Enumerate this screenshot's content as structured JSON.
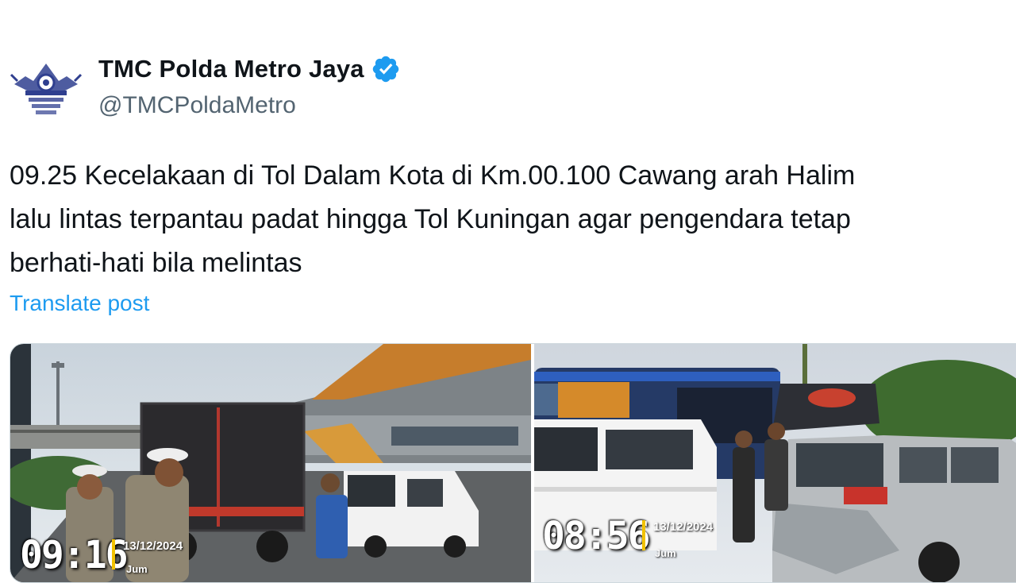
{
  "post": {
    "author": {
      "display_name": "TMC Polda Metro Jaya",
      "handle": "@TMCPoldaMetro",
      "avatar_icon": "police-emblem-icon",
      "verified_icon": "verified-badge-icon",
      "verified_color": "#1d9bf0"
    },
    "text_lines": [
      "09.25 Kecelakaan di Tol Dalam Kota di Km.00.100 Cawang arah Halim",
      "lalu lintas terpantau padat hingga Tol Kuningan agar pengendara tetap",
      "berhati-hati bila melintas"
    ],
    "translate_label": "Translate post",
    "media": [
      {
        "time": "09:16",
        "date": "13/12/2024",
        "day": "Jum"
      },
      {
        "time": "08:56",
        "date": "13/12/2024",
        "day": "Jum"
      }
    ]
  },
  "colors": {
    "link": "#1d9bf0",
    "secondary_text": "#536471",
    "primary_text": "#0f1419"
  }
}
